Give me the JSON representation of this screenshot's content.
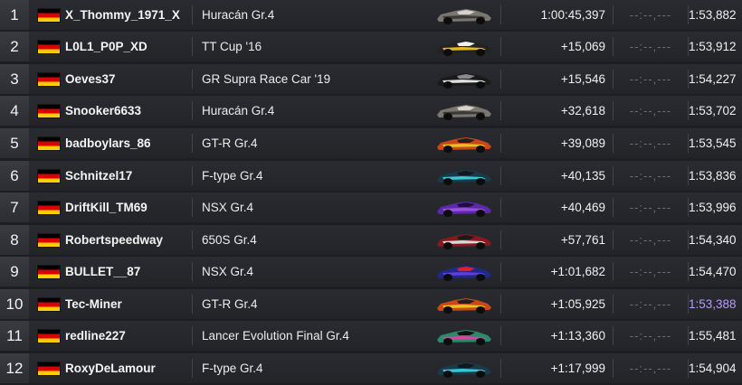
{
  "rows": [
    {
      "position": "1",
      "name": "X_Thommy_1971_X",
      "car": "Huracán Gr.4",
      "gap": "1:00:45,397",
      "lap": "--:--,---",
      "best": "1:53,882",
      "livery": [
        "#7a7670",
        "#3c3a38",
        "#d8d2c8"
      ]
    },
    {
      "position": "2",
      "name": "L0L1_P0P_XD",
      "car": "TT Cup '16",
      "gap": "+15,069",
      "lap": "--:--,---",
      "best": "1:53,912",
      "livery": [
        "#222222",
        "#e6b820",
        "#f0f0f0"
      ]
    },
    {
      "position": "3",
      "name": "Oeves37",
      "car": "GR Supra Race Car '19",
      "gap": "+15,546",
      "lap": "--:--,---",
      "best": "1:54,227",
      "livery": [
        "#1a1a1a",
        "#e0e0e0",
        "#8a8a8a"
      ]
    },
    {
      "position": "4",
      "name": "Snooker6633",
      "car": "Huracán Gr.4",
      "gap": "+32,618",
      "lap": "--:--,---",
      "best": "1:53,702",
      "livery": [
        "#7a7670",
        "#3c3a38",
        "#d8d2c8"
      ]
    },
    {
      "position": "5",
      "name": "badboylars_86",
      "car": "GT-R Gr.4",
      "gap": "+39,089",
      "lap": "--:--,---",
      "best": "1:53,545",
      "livery": [
        "#c84818",
        "#e8c020",
        "#202020"
      ]
    },
    {
      "position": "6",
      "name": "Schnitzel17",
      "car": "F-type Gr.4",
      "gap": "+40,135",
      "lap": "--:--,---",
      "best": "1:53,836",
      "livery": [
        "#1a3a4a",
        "#38c8d8",
        "#101820"
      ]
    },
    {
      "position": "7",
      "name": "DriftKill_TM69",
      "car": "NSX Gr.4",
      "gap": "+40,469",
      "lap": "--:--,---",
      "best": "1:53,996",
      "livery": [
        "#5a2aa8",
        "#a050e0",
        "#20103a"
      ]
    },
    {
      "position": "8",
      "name": "Robertspeedway",
      "car": "650S Gr.4",
      "gap": "+57,761",
      "lap": "--:--,---",
      "best": "1:54,340",
      "livery": [
        "#8a1820",
        "#d8d8d8",
        "#1a1a1a"
      ]
    },
    {
      "position": "9",
      "name": "BULLET__87",
      "car": "NSX Gr.4",
      "gap": "+1:01,682",
      "lap": "--:--,---",
      "best": "1:54,470",
      "livery": [
        "#1e2a8a",
        "#6a3ad8",
        "#e02030"
      ]
    },
    {
      "position": "10",
      "name": "Tec-Miner",
      "car": "GT-R Gr.4",
      "gap": "+1:05,925",
      "lap": "--:--,---",
      "best": "1:53,388",
      "livery": [
        "#c84818",
        "#e8c020",
        "#202020"
      ]
    },
    {
      "position": "11",
      "name": "redline227",
      "car": "Lancer Evolution Final Gr.4",
      "gap": "+1:13,360",
      "lap": "--:--,---",
      "best": "1:55,481",
      "livery": [
        "#2a8a6a",
        "#e040a0",
        "#101010"
      ]
    },
    {
      "position": "12",
      "name": "RoxyDeLamour",
      "car": "F-type Gr.4",
      "gap": "+1:17,999",
      "lap": "--:--,---",
      "best": "1:54,904",
      "livery": [
        "#1a3a4a",
        "#38c8d8",
        "#101820"
      ]
    }
  ],
  "fastest_lap_color": "#b69cff",
  "fastest_lap_position": "10",
  "flag": "germany-flag-icon"
}
